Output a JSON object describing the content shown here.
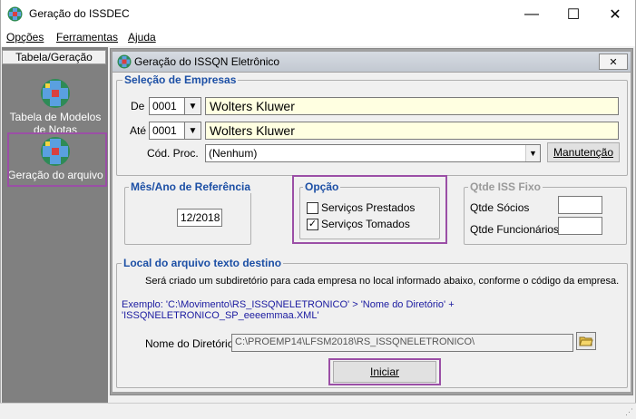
{
  "window": {
    "title": "Geração do ISSDEC",
    "minimize": "—",
    "maximize": "☐",
    "close": "✕"
  },
  "menu": {
    "items": [
      {
        "label": "Opções"
      },
      {
        "label": "Ferramentas"
      },
      {
        "label": "Ajuda"
      }
    ]
  },
  "sidebar": {
    "header": "Tabela/Geração",
    "items": [
      {
        "label": "Tabela de Modelos de Notas"
      },
      {
        "label": "Geração do arquivo"
      }
    ]
  },
  "child_window": {
    "title": "Geração do ISSQN Eletrônico",
    "close": "✕"
  },
  "empresas": {
    "title": "Seleção de Empresas",
    "de_label": "De",
    "de_code": "0001",
    "de_name": "Wolters Kluwer",
    "ate_label": "Até",
    "ate_code": "0001",
    "ate_name": "Wolters Kluwer",
    "cod_proc_label": "Cód. Proc.",
    "cod_proc_value": "(Nenhum)",
    "manutencao": "Manutenção"
  },
  "referencia": {
    "title": "Mês/Ano de Referência",
    "value": "12/2018"
  },
  "opcao": {
    "title": "Opção",
    "servicos_prestados": "Serviços Prestados",
    "servicos_tomados": "Serviços Tomados",
    "prestados_checked": false,
    "tomados_checked": true
  },
  "qtde": {
    "title": "Qtde ISS Fixo",
    "socios": "Qtde Sócios",
    "funcionarios": "Qtde Funcionários"
  },
  "local": {
    "title": "Local do arquivo texto destino",
    "info": "Será criado um subdiretório para cada empresa no local informado abaixo, conforme o código da empresa.",
    "example": "Exemplo: 'C:\\Movimento\\RS_ISSQNELETRONICO' > 'Nome do Diretório' + 'ISSQNELETRONICO_SP_eeeemmaa.XML'",
    "dir_label": "Nome do Diretório",
    "dir_value": "C:\\PROEMP14\\LFSM2018\\RS_ISSQNELETRONICO\\"
  },
  "actions": {
    "iniciar": "Iniciar"
  },
  "colors": {
    "accent_title": "#1c4fa5",
    "highlight": "#9b4fa6",
    "name_bg": "#ffffe1",
    "example_text": "#1a1aa0"
  }
}
